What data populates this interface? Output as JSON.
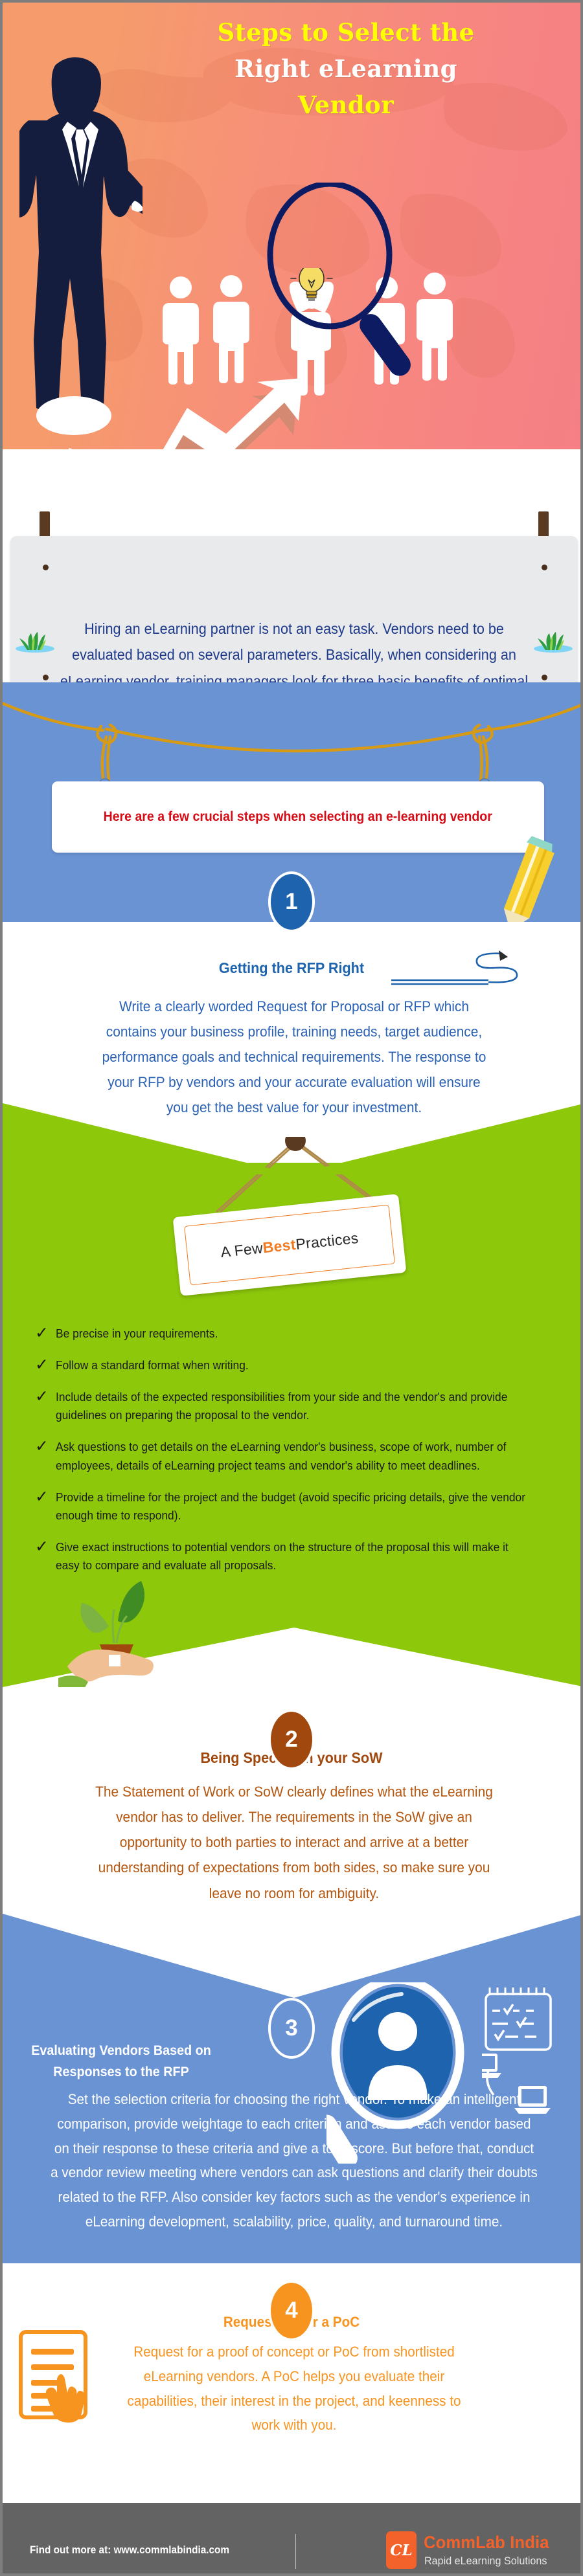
{
  "header": {
    "title_line1": "Steps to Select the",
    "title_line2": "Right eLearning",
    "title_line3": "Vendor",
    "colors": {
      "yellow": "#ffff00",
      "white": "#ffffff",
      "bg_left": "#f59b6c",
      "bg_right": "#f57f85"
    }
  },
  "intro": {
    "text": "Hiring an eLearning partner is not an easy task. Vendors need to be evaluated based on several parameters. Basically, when considering an eLearning vendor, training managers look for three basic benefits of optimal cost, effort and value for money. They are also looking at a collaborative partnership that will benefit them long-term.",
    "text_color": "#1e3a8c",
    "board_color": "#e9eaeb"
  },
  "banner": {
    "text": "Here are a few crucial steps when selecting an e-learning vendor",
    "text_color": "#d60c17",
    "band_color": "#6a93d4"
  },
  "steps": [
    {
      "number": "1",
      "badge_color": "#1e63ad",
      "title": "Getting the RFP Right",
      "title_color": "#1e63ad",
      "body": "Write a clearly worded Request for Proposal or RFP which contains your business profile, training needs, target audience, performance goals and technical requirements. The response to your RFP by vendors and your accurate evaluation will ensure you get the best value for your investment.",
      "body_color": "#2b62b5"
    },
    {
      "number": "2",
      "badge_color": "#a0480d",
      "title": "Being Specific in your SoW",
      "title_color": "#a0480d",
      "body": "The Statement of Work or SoW clearly defines what the eLearning vendor has to deliver. The requirements in the SoW give an opportunity to both parties to interact and arrive at a better understanding of expectations from both sides, so make sure you leave no room for ambiguity.",
      "body_color": "#b5560f"
    },
    {
      "number": "3",
      "badge_color": "#6a93d4",
      "title": "Evaluating Vendors Based on Responses to the RFP",
      "title_color": "#ffffff",
      "body": "Set the selection criteria for choosing the right vendor. To make an intelligent comparison, provide weightage to each criterion and assess each vendor based on their response to these criteria and give a total score. But before that, conduct a vendor review meeting where vendors can ask questions and clarify their doubts related to the RFP. Also consider key factors such as the vendor's experience in eLearning development, scalability, price, quality, and turnaround time.",
      "body_color": "#ffffff"
    },
    {
      "number": "4",
      "badge_color": "#f79420",
      "title": "Requesting for a PoC",
      "title_color": "#f79420",
      "body": "Request for a proof of concept or PoC from shortlisted eLearning vendors. A PoC helps you evaluate their capabilities, their interest in the project, and keenness to work with you.",
      "body_color": "#f79420"
    }
  ],
  "best_practices": {
    "sign_text_pre": "A Few ",
    "sign_text_hi": "Best",
    "sign_text_post": " Practices",
    "bg_color": "#8dc80b",
    "items": [
      "Be precise in your requirements.",
      "Follow a standard format when writing.",
      "Include details of the expected responsibilities from your side and the vendor's and provide guidelines on preparing the proposal to the vendor.",
      "Ask questions to get details on the eLearning vendor's business, scope of work, number of employees, details of eLearning project teams and vendor's ability to meet deadlines.",
      "Provide a timeline for the project and the budget (avoid specific pricing details, give the vendor enough time to respond).",
      "Give exact instructions to potential vendors on the structure of the proposal this will make it easy to compare and evaluate all proposals."
    ],
    "check_glyph": "✓"
  },
  "footer": {
    "find_out": "Find out more at: www.commlabindia.com",
    "logo_mark": "CL",
    "logo_name": "CommLab India",
    "logo_tagline": "Rapid eLearning Solutions",
    "bg_color": "#636363",
    "accent": "#f2622a"
  }
}
